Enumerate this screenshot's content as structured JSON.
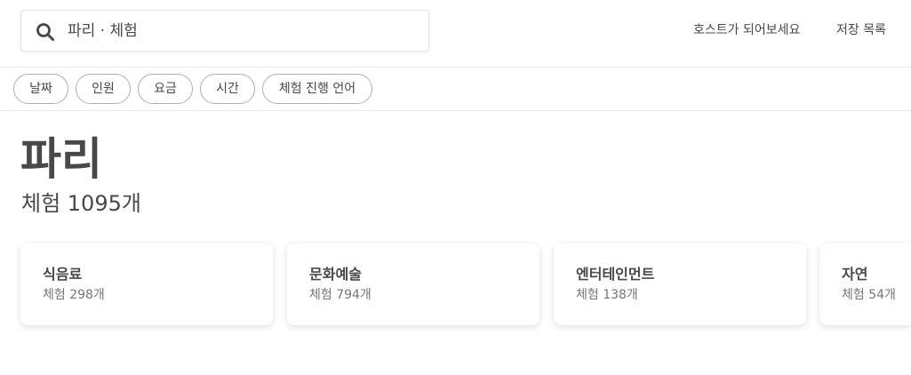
{
  "header": {
    "search_value": "파리 · 체험",
    "search_icon": "search-icon",
    "nav": {
      "host_label": "호스트가 되어보세요",
      "saved_label": "저장 목록"
    }
  },
  "filters": [
    {
      "label": "날짜"
    },
    {
      "label": "인원"
    },
    {
      "label": "요금"
    },
    {
      "label": "시간"
    },
    {
      "label": "체험 진행 언어"
    }
  ],
  "main": {
    "title": "파리",
    "subtitle": "체험 1095개"
  },
  "categories": [
    {
      "name": "식음료",
      "count": "체험 298개"
    },
    {
      "name": "문화예술",
      "count": "체험 794개"
    },
    {
      "name": "엔터테인먼트",
      "count": "체험 138개"
    },
    {
      "name": "자연",
      "count": "체험 54개"
    }
  ],
  "colors": {
    "text": "#484848",
    "muted_text": "#767676",
    "border": "#ebebeb"
  }
}
